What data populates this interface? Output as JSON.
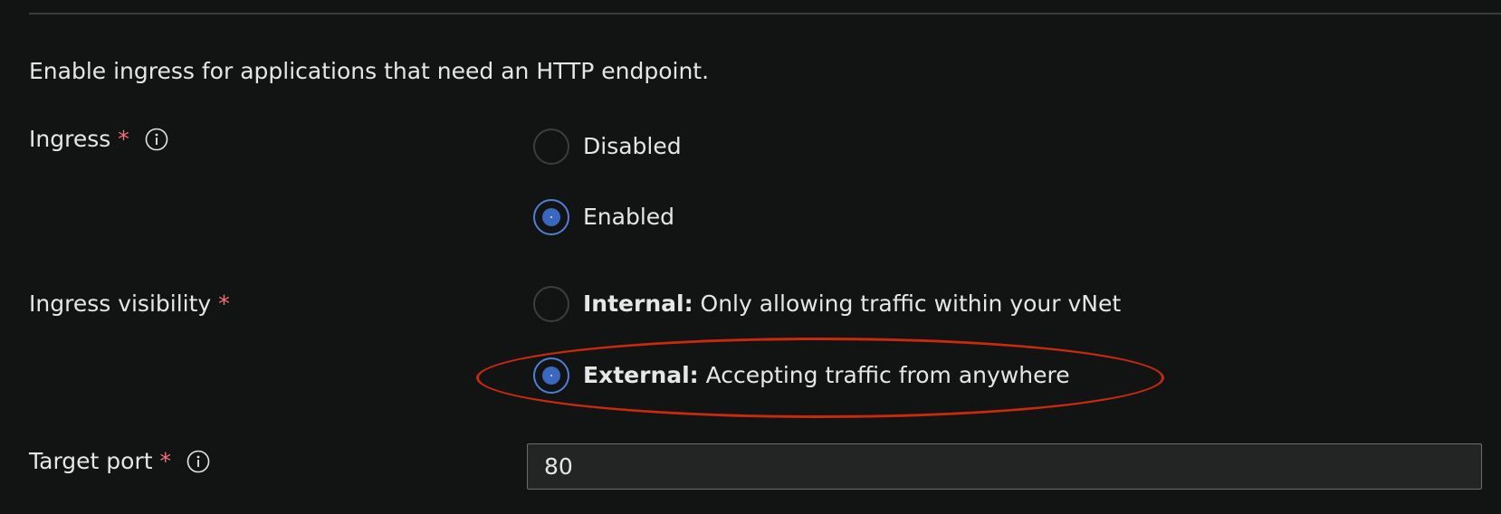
{
  "intro_text": "Enable ingress for applications that need an HTTP endpoint.",
  "ingress": {
    "label": "Ingress",
    "required_mark": "*",
    "options": [
      {
        "label": "Disabled",
        "selected": false
      },
      {
        "label": "Enabled",
        "selected": true
      }
    ]
  },
  "ingress_visibility": {
    "label": "Ingress visibility",
    "required_mark": "*",
    "options": [
      {
        "bold": "Internal:",
        "text": "Only allowing traffic within your vNet",
        "selected": false
      },
      {
        "bold": "External:",
        "text": "Accepting traffic from anywhere",
        "selected": true
      }
    ]
  },
  "target_port": {
    "label": "Target port",
    "required_mark": "*",
    "value": "80"
  },
  "icons": {
    "info": "info-icon"
  },
  "colors": {
    "background": "#121313",
    "required": "#f1707b",
    "radio_selected": "#3b67be",
    "highlight": "#c8290f"
  }
}
